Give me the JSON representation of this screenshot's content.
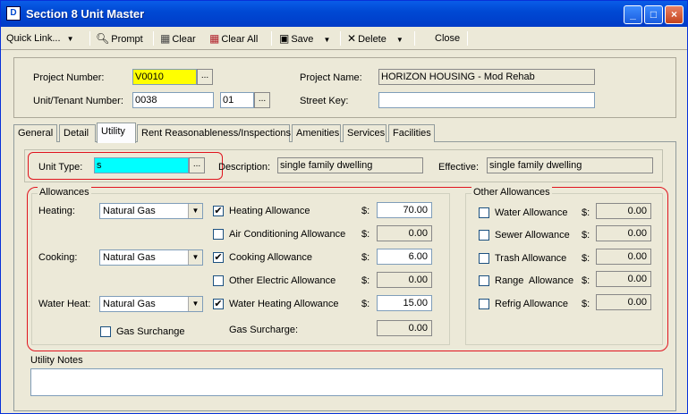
{
  "window": {
    "title": "Section 8 Unit Master"
  },
  "toolbar": {
    "quick_link": "Quick Link...",
    "prompt": "Prompt",
    "clear": "Clear",
    "clear_all": "Clear All",
    "save": "Save",
    "delete": "Delete",
    "close": "Close"
  },
  "header": {
    "project_number_label": "Project Number:",
    "project_number": "V0010",
    "project_name_label": "Project Name:",
    "project_name": "HORIZON HOUSING - Mod Rehab",
    "unit_tenant_label": "Unit/Tenant Number:",
    "unit_number": "0038",
    "tenant_number": "01",
    "street_key_label": "Street Key:",
    "street_key": ""
  },
  "tabs": [
    "General",
    "Detail",
    "Utility",
    "Rent Reasonableness/Inspections",
    "Amenities",
    "Services",
    "Facilities"
  ],
  "utility": {
    "unit_type_label": "Unit Type:",
    "unit_type": "s",
    "description_label": "Description:",
    "description": "single family dwelling",
    "effective_label": "Effective:",
    "effective": "single family dwelling"
  },
  "allowances": {
    "title": "Allowances",
    "heating_label": "Heating:",
    "heating_fuel": "Natural Gas",
    "cooking_label": "Cooking:",
    "cooking_fuel": "Natural Gas",
    "water_heat_label": "Water Heat:",
    "water_heat_fuel": "Natural Gas",
    "gas_surcharge_check_label": "Gas Surchange",
    "gas_surcharge_check": false,
    "items": [
      {
        "label": "Heating Allowance",
        "checked": true,
        "currency": "$:",
        "value": "70.00"
      },
      {
        "label": "Air Conditioning Allowance",
        "checked": false,
        "currency": "$:",
        "value": "0.00"
      },
      {
        "label": "Cooking Allowance",
        "checked": true,
        "currency": "$:",
        "value": "6.00"
      },
      {
        "label": "Other Electric Allowance",
        "checked": false,
        "currency": "$:",
        "value": "0.00"
      },
      {
        "label": "Water Heating Allowance",
        "checked": true,
        "currency": "$:",
        "value": "15.00"
      }
    ],
    "gas_surcharge_label": "Gas Surcharge:",
    "gas_surcharge_value": "0.00"
  },
  "other_allowances": {
    "title": "Other Allowances",
    "items": [
      {
        "label": "Water Allowance",
        "checked": false,
        "currency": "$:",
        "value": "0.00"
      },
      {
        "label": "Sewer Allowance",
        "checked": false,
        "currency": "$:",
        "value": "0.00"
      },
      {
        "label": "Trash Allowance",
        "checked": false,
        "currency": "$:",
        "value": "0.00"
      },
      {
        "label": "Range  Allowance",
        "checked": false,
        "currency": "$:",
        "value": "0.00"
      },
      {
        "label": "Refrig Allowance",
        "checked": false,
        "currency": "$:",
        "value": "0.00"
      }
    ]
  },
  "notes": {
    "label": "Utility Notes",
    "value": ""
  },
  "ellipsis": "...",
  "check_mark": "✔",
  "colors": {
    "highlight_yellow": "#ffff00",
    "highlight_cyan": "#00ffff",
    "annotation_red": "#e0141e",
    "title_blue": "#0049d4"
  }
}
